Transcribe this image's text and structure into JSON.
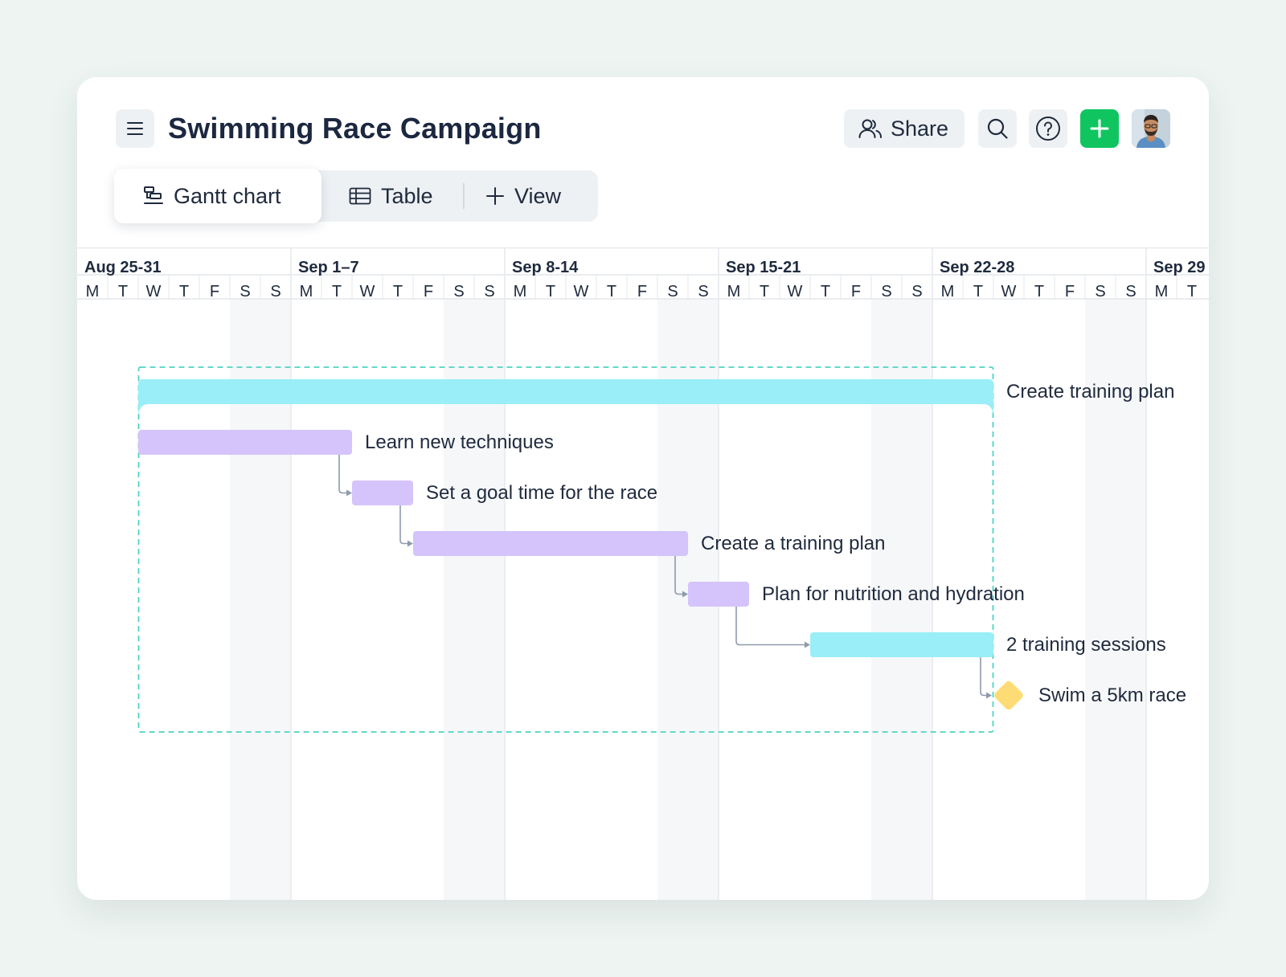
{
  "app": {
    "title": "Swimming Race Campaign"
  },
  "header": {
    "menu_icon": "hamburger-menu-icon",
    "share_label": "Share",
    "share_icon": "users-icon",
    "search_icon": "search-icon",
    "help_icon": "help-circle-icon",
    "add_icon": "plus-icon",
    "accent_color": "#10c560"
  },
  "tabs": [
    {
      "label": "Gantt chart",
      "icon": "gantt-icon",
      "active": true
    },
    {
      "label": "Table",
      "icon": "table-icon",
      "active": false
    },
    {
      "label": "View",
      "icon": "plus-icon",
      "active": false
    }
  ],
  "timeline": {
    "weeks": [
      "Aug 25-31",
      "Sep 1–7",
      "Sep 8-14",
      "Sep 15-21",
      "Sep 22-28",
      "Sep 29"
    ],
    "days": [
      "M",
      "T",
      "W",
      "T",
      "F",
      "S",
      "S",
      "M",
      "T",
      "W",
      "T",
      "F",
      "S",
      "S",
      "M",
      "T",
      "W",
      "T",
      "F",
      "S",
      "S",
      "M",
      "T",
      "W",
      "T",
      "F",
      "S",
      "S",
      "M",
      "T",
      "W",
      "T",
      "F",
      "S",
      "S",
      "M",
      "T"
    ],
    "start_date": "2025-08-25"
  },
  "tasks": [
    {
      "name": "Create training plan",
      "type": "group",
      "start": "2025-08-27",
      "end": "2025-09-23",
      "color": "#99eef8"
    },
    {
      "name": "Learn new techniques",
      "type": "task",
      "start": "2025-08-27",
      "end": "2025-09-02",
      "color": "#d4c4fb"
    },
    {
      "name": "Set a goal time for the race",
      "type": "task",
      "start": "2025-09-03",
      "end": "2025-09-04",
      "color": "#d4c4fb"
    },
    {
      "name": "Create a training plan",
      "type": "task",
      "start": "2025-09-05",
      "end": "2025-09-13",
      "color": "#d4c4fb"
    },
    {
      "name": "Plan for nutrition and hydration",
      "type": "task",
      "start": "2025-09-14",
      "end": "2025-09-15",
      "color": "#d4c4fb"
    },
    {
      "name": "2 training sessions",
      "type": "task",
      "start": "2025-09-18",
      "end": "2025-09-23",
      "color": "#99eef8"
    },
    {
      "name": "Swim a 5km race",
      "type": "milestone",
      "start": "2025-09-24",
      "color": "#fedc75"
    }
  ],
  "dependencies": [
    [
      1,
      2
    ],
    [
      2,
      3
    ],
    [
      3,
      4
    ],
    [
      4,
      5
    ],
    [
      5,
      6
    ]
  ],
  "group_border_color": "#4fd3c4",
  "weekend_shade": "#f6f7f9"
}
